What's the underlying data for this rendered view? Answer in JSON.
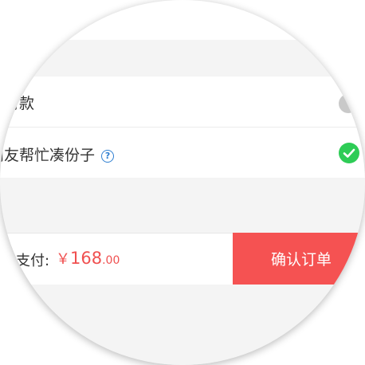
{
  "section_header": {
    "text": "。"
  },
  "payment_options": [
    {
      "label": "已付款",
      "selected": false
    },
    {
      "label": "朋友帮忙凑份子",
      "help_icon": "question-circle-icon",
      "selected": true
    }
  ],
  "footer": {
    "pay_label": "支付:",
    "currency": "￥",
    "amount_int": "168",
    "amount_dec": ".00",
    "confirm_label": "确认订单"
  },
  "colors": {
    "accent_red": "#f55252",
    "price_red": "#f05050",
    "check_green": "#2ecc56",
    "help_blue": "#2f7fd1"
  }
}
